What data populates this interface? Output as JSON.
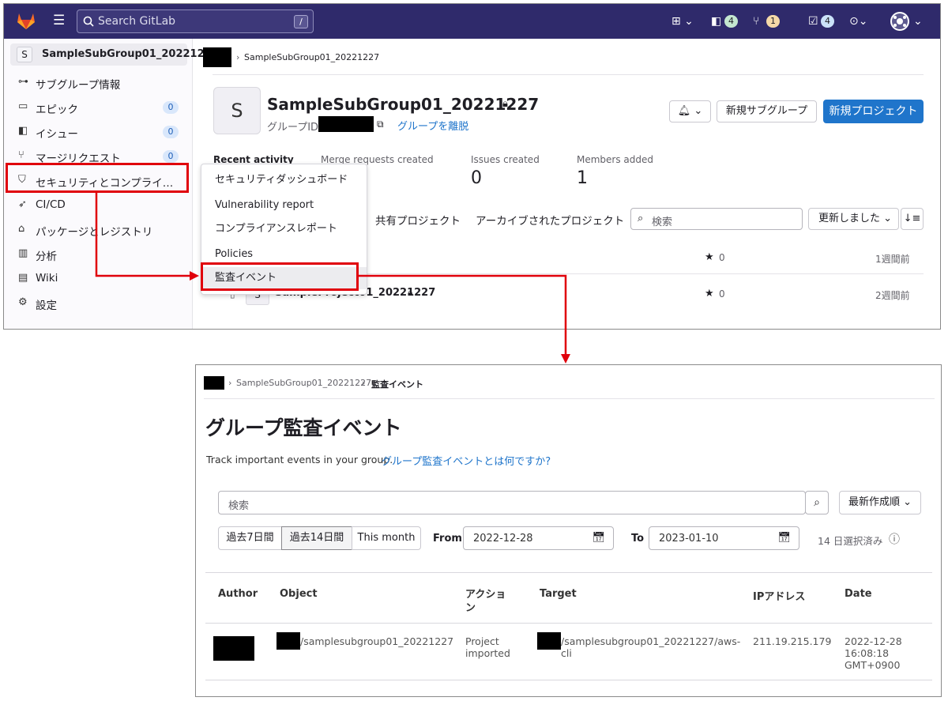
{
  "top": {
    "search": {
      "placeholder": "Search GitLab",
      "shortcut": "/"
    },
    "header_badges": {
      "issues_badge": "4",
      "mr_badge": "1",
      "todo_badge": "4"
    },
    "colors": {
      "topbar": "#2f2a6b",
      "primary": "#1f75cb",
      "highlight_red": "#e0000b"
    },
    "breadcrumb": {
      "group": "SampleSubGroup01_20221227"
    },
    "sidebar": {
      "group_avatar": "S",
      "group_name": "SampleSubGroup01_20221227",
      "items": [
        {
          "label": "サブグループ情報",
          "icon": "subgroup-icon"
        },
        {
          "label": "エピック",
          "count": "0",
          "icon": "epic-icon"
        },
        {
          "label": "イシュー",
          "count": "0",
          "icon": "issues-icon"
        },
        {
          "label": "マージリクエスト",
          "count": "0",
          "icon": "merge-request-icon"
        },
        {
          "label": "セキュリティとコンプライ…",
          "icon": "shield-icon"
        },
        {
          "label": "CI/CD",
          "icon": "rocket-icon"
        },
        {
          "label": "パッケージとレジストリ",
          "icon": "package-icon"
        },
        {
          "label": "分析",
          "icon": "chart-icon"
        },
        {
          "label": "Wiki",
          "icon": "book-icon"
        },
        {
          "label": "設定",
          "icon": "gear-icon"
        }
      ]
    },
    "flyout": [
      "セキュリティダッシュボード",
      "Vulnerability report",
      "コンプライアンスレポート",
      "Policies",
      "監査イベント"
    ],
    "group_header": {
      "avatar": "S",
      "name": "SampleSubGroup01_20221227",
      "id_label": "グループID:",
      "leave_link": "グループを離脱",
      "new_subgroup": "新規サブグループ",
      "new_project": "新規プロジェクト"
    },
    "stats": {
      "recent_activity": "Recent activity",
      "mr_created": "Merge requests created",
      "issues_created": "Issues created",
      "issues_value": "0",
      "members_added": "Members added",
      "members_value": "1"
    },
    "tabs": {
      "shared": "共有プロジェクト",
      "archived": "アーカイブされたプロジェクト"
    },
    "filter": {
      "search_placeholder": "検索",
      "sort": "更新しました"
    },
    "projects": [
      {
        "stars": "0",
        "updated": "1週間前"
      },
      {
        "avatar": "S",
        "name": "SampleProject01_20221227",
        "stars": "0",
        "updated": "2週間前"
      }
    ]
  },
  "bottom": {
    "breadcrumb": {
      "group": "SampleSubGroup01_20221227",
      "current": "監査イベント"
    },
    "title": "グループ監査イベント",
    "description": "Track important events in your group.",
    "help_link": "グループ監査イベントとは何ですか?",
    "search_placeholder": "検索",
    "sort": "最新作成順",
    "ranges": [
      "過去7日間",
      "過去14日間",
      "This month"
    ],
    "from_label": "From",
    "from_date": "2022-12-28",
    "to_label": "To",
    "to_date": "2023-01-10",
    "selected": "14 日選択済み",
    "table": {
      "headers": [
        "Author",
        "Object",
        "アクション",
        "Target",
        "IPアドレス",
        "Date"
      ],
      "row": {
        "object": "/samplesubgroup01_20221227",
        "action": "Project imported",
        "target": "/samplesubgroup01_20221227/aws-cli",
        "ip": "211.19.215.179",
        "date": "2022-12-28 16:08:18 GMT+0900"
      }
    }
  }
}
